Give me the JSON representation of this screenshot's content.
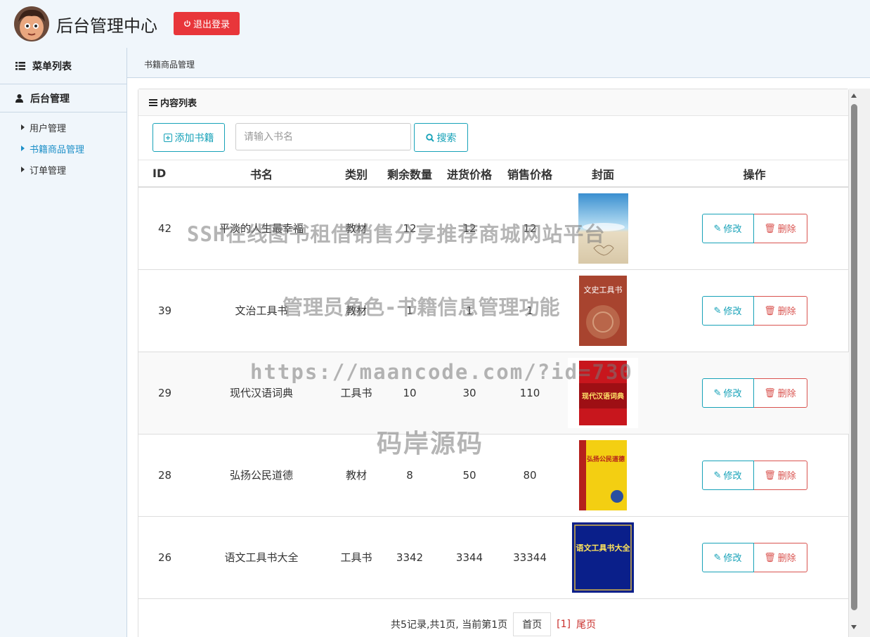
{
  "header": {
    "title": "后台管理中心",
    "logout_label": "退出登录"
  },
  "sidebar": {
    "menu_title": "菜单列表",
    "group_title": "后台管理",
    "items": [
      {
        "label": "用户管理",
        "active": false
      },
      {
        "label": "书籍商品管理",
        "active": true
      },
      {
        "label": "订单管理",
        "active": false
      }
    ]
  },
  "breadcrumb": "书籍商品管理",
  "panel": {
    "title": "内容列表",
    "add_label": "添加书籍",
    "search_placeholder": "请输入书名",
    "search_label": "搜索"
  },
  "table": {
    "headers": [
      "ID",
      "书名",
      "类别",
      "剩余数量",
      "进货价格",
      "销售价格",
      "封面",
      "操作"
    ],
    "edit_label": "修改",
    "delete_label": "删除",
    "rows": [
      {
        "id": "42",
        "name": "平淡的人生最幸福",
        "category": "教材",
        "stock": "12",
        "cost": "12",
        "price": "12",
        "cover_text": ""
      },
      {
        "id": "39",
        "name": "文治工具书",
        "category": "教材",
        "stock": "1",
        "cost": "1",
        "price": "1",
        "cover_text": "文史工具书"
      },
      {
        "id": "29",
        "name": "现代汉语词典",
        "category": "工具书",
        "stock": "10",
        "cost": "30",
        "price": "110",
        "cover_text": "现代汉语词典"
      },
      {
        "id": "28",
        "name": "弘扬公民道德",
        "category": "教材",
        "stock": "8",
        "cost": "50",
        "price": "80",
        "cover_text": "弘扬公民道德"
      },
      {
        "id": "26",
        "name": "语文工具书大全",
        "category": "工具书",
        "stock": "3342",
        "cost": "3344",
        "price": "33344",
        "cover_text": "语文工具书大全"
      }
    ]
  },
  "pagination": {
    "summary": "共5记录,共1页, 当前第1页",
    "first_label": "首页",
    "current": "[1]",
    "last_label": "尾页"
  },
  "watermark": {
    "line1": "SSH在线图书租借销售分享推荐商城网站平台",
    "line2": "管理员角色-书籍信息管理功能",
    "line3": "https://maancode.com/?id=730",
    "line4": "码岸源码"
  },
  "colors": {
    "accent": "#17a2b8",
    "danger": "#d9534f",
    "logout": "#e8363a",
    "sidebar_bg": "#f0f6fb",
    "active_link": "#1e90c8"
  }
}
